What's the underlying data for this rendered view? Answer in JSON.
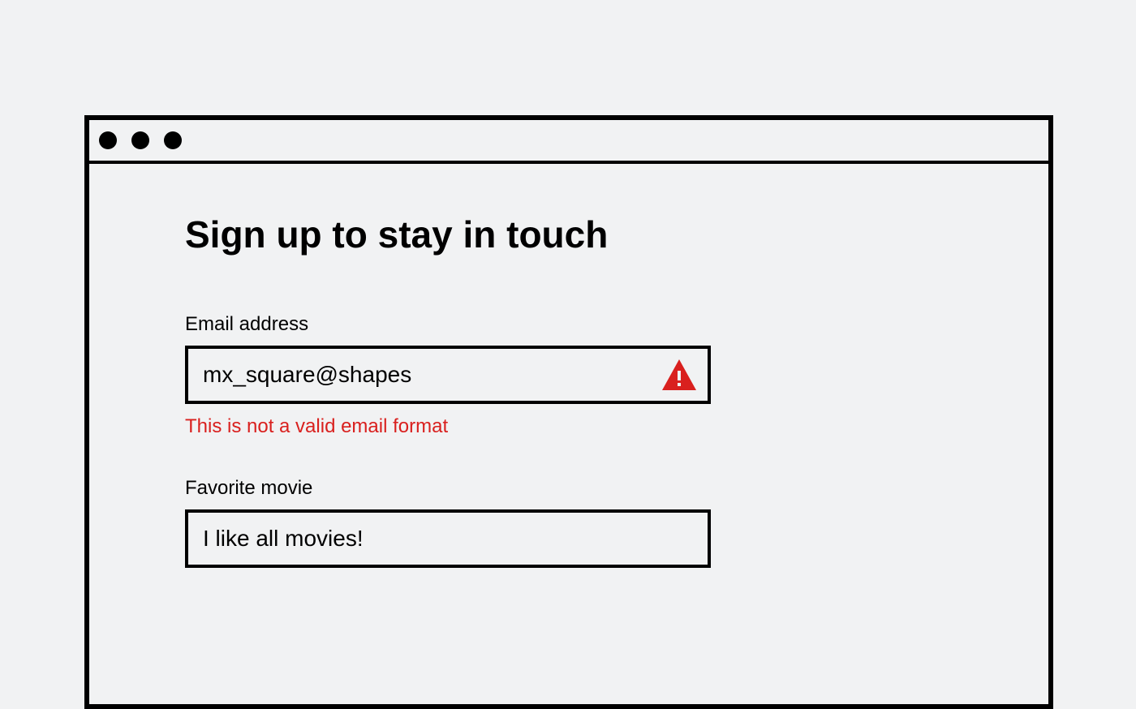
{
  "form": {
    "heading": "Sign up to stay in touch",
    "email": {
      "label": "Email address",
      "value": "mx_square@shapes",
      "error": "This is not a valid email format"
    },
    "movie": {
      "label": "Favorite movie",
      "value": "I like all movies!"
    }
  },
  "colors": {
    "error": "#d9201e"
  }
}
